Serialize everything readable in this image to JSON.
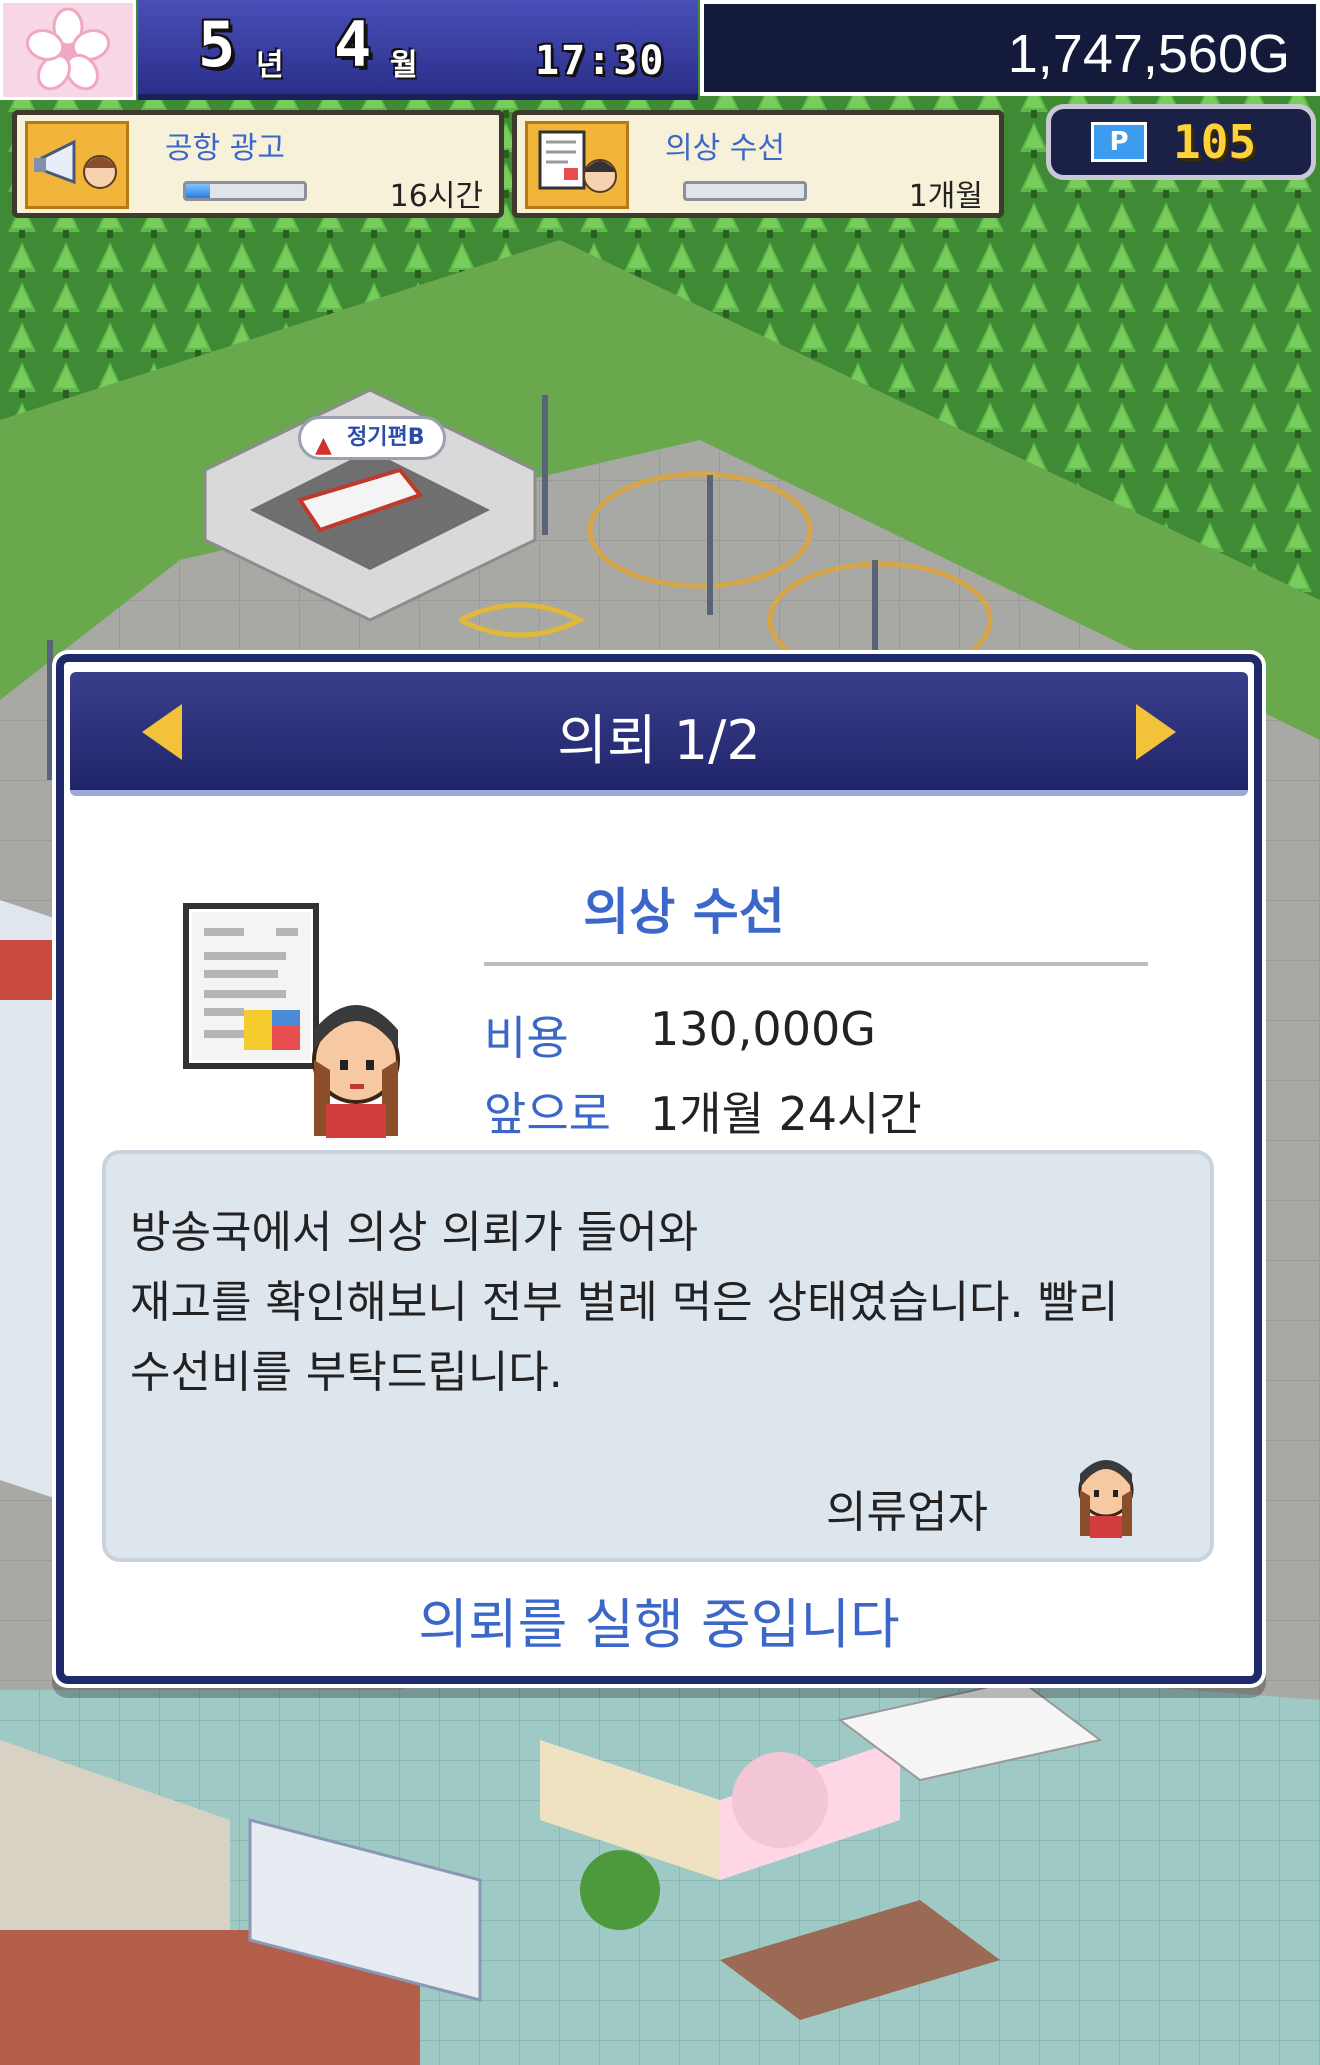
{
  "hud": {
    "year": "5",
    "year_unit": "년",
    "month": "4",
    "month_unit": "월",
    "time": "17:30",
    "money": "1,747,560G",
    "points": "105",
    "points_icon": "P",
    "season_icon": "cherry-blossom-icon"
  },
  "tasks": [
    {
      "title": "공항 광고",
      "remaining": "16시간",
      "progress": 0.2,
      "icon": "megaphone-icon"
    },
    {
      "title": "의상 수선",
      "remaining": "1개월",
      "progress": 0.0,
      "icon": "document-icon"
    }
  ],
  "map": {
    "hangar_label": "정기편B"
  },
  "dialog": {
    "title": "의뢰 1/2",
    "request_title": "의상 수선",
    "cost_label": "비용",
    "cost_value": "130,000G",
    "remaining_label": "앞으로",
    "remaining_value": "1개월 24시간",
    "message_lines": [
      "방송국에서 의상 의뢰가 들어와",
      "재고를 확인해보니 전부 벌레 먹은 상태였습니다. 빨리",
      "수선비를 부탁드립니다."
    ],
    "sender": "의류업자",
    "status": "의뢰를 실행 중입니다"
  },
  "colors": {
    "accent_blue": "#3b67c9",
    "header_navy": "#20246a",
    "arrow_gold": "#f2c33a",
    "points_gold": "#ffd23a"
  }
}
